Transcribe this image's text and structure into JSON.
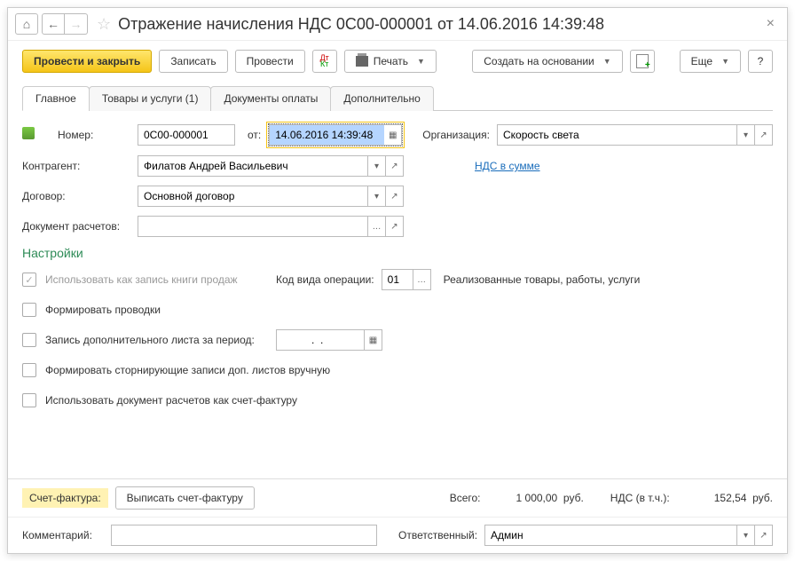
{
  "title": "Отражение начисления НДС 0С00-000001 от 14.06.2016 14:39:48",
  "toolbar": {
    "post_close": "Провести и закрыть",
    "save": "Записать",
    "post": "Провести",
    "print": "Печать",
    "based_on": "Создать на основании",
    "more": "Еще",
    "help": "?"
  },
  "tabs": {
    "main": "Главное",
    "goods": "Товары и услуги (1)",
    "payments": "Документы оплаты",
    "extra": "Дополнительно"
  },
  "labels": {
    "number": "Номер:",
    "from": "от:",
    "org": "Организация:",
    "counterparty": "Контрагент:",
    "contract": "Договор:",
    "settlement_doc": "Документ расчетов:",
    "settings": "Настройки",
    "use_as_sales_book": "Использовать как запись книги продаж",
    "op_type": "Код вида операции:",
    "op_desc": "Реализованные товары, работы, услуги",
    "form_postings": "Формировать проводки",
    "extra_sheet": "Запись дополнительного листа за период:",
    "storno": "Формировать сторнирующие записи доп. листов вручную",
    "use_settlement_as_invoice": "Использовать документ расчетов как счет-фактуру",
    "vat_in_sum": "НДС в сумме",
    "invoice": "Счет-фактура:",
    "write_invoice": "Выписать счет-фактуру",
    "comment": "Комментарий:",
    "responsible": "Ответственный:"
  },
  "fields": {
    "number": "0С00-000001",
    "date": "14.06.2016 14:39:48",
    "org": "Скорость света",
    "counterparty": "Филатов Андрей Васильевич",
    "contract": "Основной договор",
    "settlement_doc": "",
    "op_code": "01",
    "extra_period": "  .  .    ",
    "comment": "",
    "responsible": "Админ"
  },
  "totals": {
    "total_label": "Всего:",
    "total_value": "1 000,00",
    "currency": "руб.",
    "vat_label": "НДС (в т.ч.):",
    "vat_value": "152,54"
  }
}
